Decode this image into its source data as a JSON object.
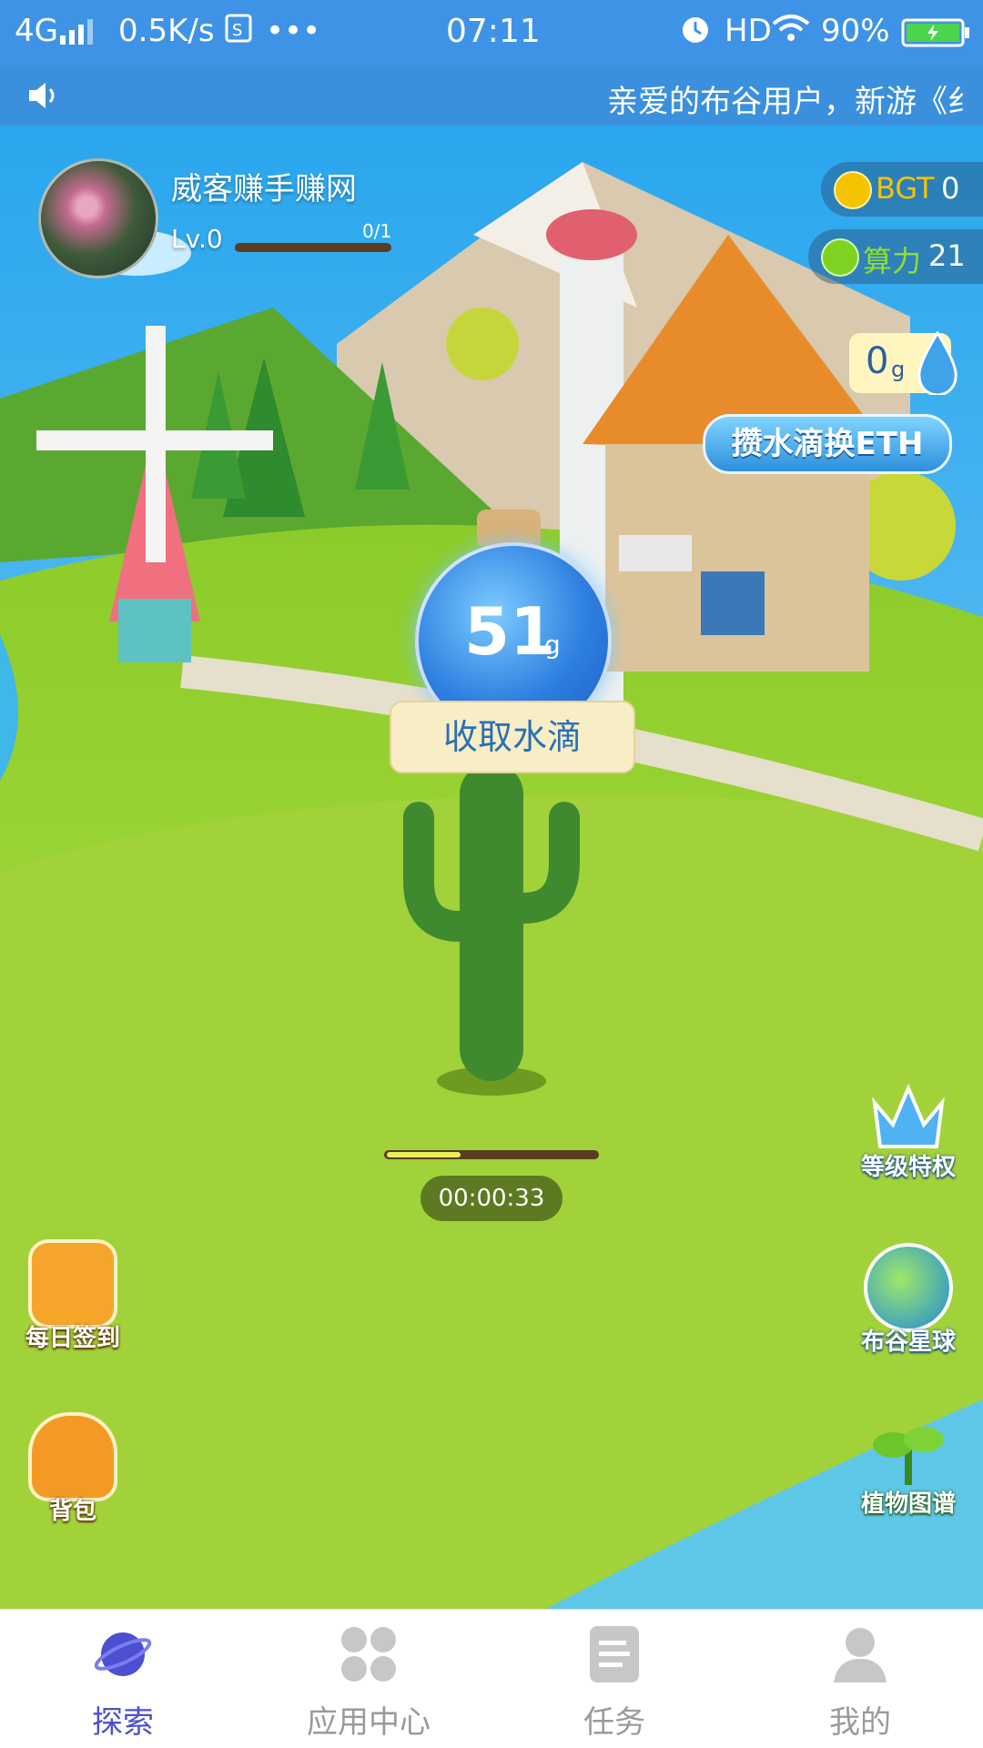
{
  "status_bar": {
    "network": "4G",
    "speed": "0.5K/s",
    "time": "07:11",
    "hd": "HD",
    "battery": "90%"
  },
  "announcement": {
    "text": "亲爱的布谷用户，新游《纟"
  },
  "profile": {
    "username": "威客赚手赚网",
    "level": "Lv.0",
    "xp_count": "0/1",
    "xp_progress": 0
  },
  "currencies": [
    {
      "label": "BGT",
      "value": "0",
      "icon": "bgt-coin-icon",
      "label_color": "#f5c400"
    },
    {
      "label": "算力",
      "value": "21",
      "icon": "lightning-icon",
      "label_color": "#8fe02e"
    }
  ],
  "water": {
    "value": "0",
    "unit": "g",
    "exchange_label": "攒水滴换ETH"
  },
  "bottle": {
    "value": "51",
    "unit": "g",
    "collect_label": "收取水滴"
  },
  "growth": {
    "progress": 0.35,
    "timer": "00:00:33"
  },
  "side_buttons_left": [
    {
      "name": "daily-checkin-button",
      "label": "每日签到",
      "icon": "calendar-check-icon"
    },
    {
      "name": "backpack-button",
      "label": "背包",
      "icon": "backpack-icon"
    }
  ],
  "side_buttons_right": [
    {
      "name": "level-privilege-button",
      "label": "等级特权",
      "icon": "crown-icon"
    },
    {
      "name": "bugu-planet-button",
      "label": "布谷星球",
      "icon": "planet-icon"
    },
    {
      "name": "plant-atlas-button",
      "label": "植物图谱",
      "icon": "sprout-icon"
    }
  ],
  "tabs": [
    {
      "label": "探索",
      "icon": "planet-icon",
      "active": true
    },
    {
      "label": "应用中心",
      "icon": "apps-grid-icon",
      "active": false
    },
    {
      "label": "任务",
      "icon": "task-list-icon",
      "active": false
    },
    {
      "label": "我的",
      "icon": "person-icon",
      "active": false
    }
  ],
  "colors": {
    "accent": "#4d4fd1",
    "status_bar": "#3f93e6",
    "grass": "#a6d63a"
  }
}
